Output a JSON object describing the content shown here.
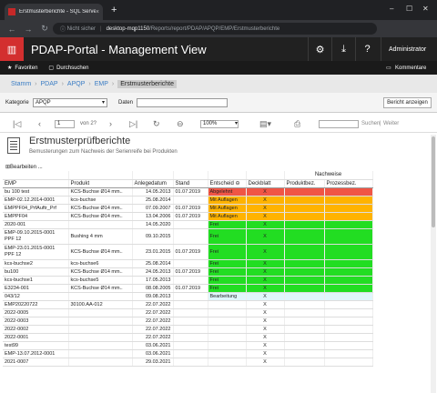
{
  "browser": {
    "tab_title": "Erstmusterberichte - SQL Server...",
    "tab_close": "×",
    "new_tab": "+",
    "win_min": "–",
    "win_max": "☐",
    "win_close": "✕",
    "security": "Nicht sicher",
    "host": "desktop-mqp1150",
    "path": "/Reports/report/PDAP/APQP/EMP/Erstmusterberichte"
  },
  "app": {
    "title": "PDAP-Portal - Management View",
    "user": "Administrator",
    "favorites": "Favoriten",
    "browse": "Durchsuchen",
    "comments": "Kommentare"
  },
  "breadcrumb": [
    "Stamm",
    "PDAP",
    "APQP",
    "EMP",
    "Erstmusterberichte"
  ],
  "params": {
    "kategorie_label": "Kategorie",
    "kategorie_value": "APQP",
    "daten_label": "Daten",
    "run": "Bericht anzeigen"
  },
  "toolbar": {
    "page": "1",
    "of": "von 2?",
    "zoom": "100%",
    "find": "Suchen",
    "next": "Weiter"
  },
  "report": {
    "title": "Erstmusterprüfberichte",
    "subtitle": "Bemusterungen zum Nachweis der Serienreife bei Produkten",
    "edit": "Bearbeiten ..."
  },
  "table": {
    "group_header": "Nachweise",
    "headers": [
      "EMP",
      "Produkt",
      "Anlegedatum",
      "Stand",
      "Entscheid",
      "Deckblatt",
      "Produktbez.",
      "Prozessbez."
    ],
    "rows": [
      [
        "bu 100 test",
        "KCS-Buchse Ø14 mm..",
        "14.05.2013",
        "01.07.2019",
        "Abgelehnt",
        "X",
        "",
        ""
      ],
      [
        "EMP-02.12.2014-0001",
        "kcs-buchse",
        "25.08.2014",
        "",
        "Mit Auflagen",
        "X",
        "",
        ""
      ],
      [
        "EMPPF04_PrfAuftr_Prf",
        "KCS-Buchse Ø14 mm..",
        "07.09.2007",
        "01.07.2019",
        "Mit Auflagen",
        "X",
        "",
        ""
      ],
      [
        "EMPPF04",
        "KCS-Buchse Ø14 mm..",
        "13.04.2006",
        "01.07.2019",
        "Mit Auflagen",
        "X",
        "",
        ""
      ],
      [
        "2020-001",
        "",
        "14.05.2020",
        "",
        "Frei",
        "X",
        "",
        ""
      ],
      [
        "EMP-09.10.2015-0001 PPF 12",
        "Bushing 4 mm",
        "09.10.2015",
        "",
        "Frei",
        "X",
        "",
        ""
      ],
      [
        "EMP-23.01.2015-0001 PPF 12",
        "KCS-Buchse Ø14 mm..",
        "23.01.2015",
        "01.07.2019",
        "Frei",
        "X",
        "",
        ""
      ],
      [
        "kcs-buchse2",
        "kcs-buchse6",
        "25.08.2014",
        "",
        "Frei",
        "X",
        "",
        ""
      ],
      [
        "bu100",
        "KCS-Buchse Ø14 mm..",
        "24.05.2013",
        "01.07.2019",
        "Frei",
        "X",
        "",
        ""
      ],
      [
        "kcs-buchse1",
        "kcs-buchse5",
        "17.05.2013",
        "",
        "Frei",
        "X",
        "",
        ""
      ],
      [
        "E3234-001",
        "KCS-Buchse Ø14 mm..",
        "08.08.2005",
        "01.07.2019",
        "Frei",
        "X",
        "",
        ""
      ],
      [
        "043/12",
        "",
        "09.08.2013",
        "",
        "Bearbeitung",
        "X",
        "",
        ""
      ],
      [
        "EMP20220722",
        "30100.AA-012",
        "22.07.2022",
        "",
        "",
        "X",
        "",
        ""
      ],
      [
        "2022-0005",
        "",
        "22.07.2022",
        "",
        "",
        "X",
        "",
        ""
      ],
      [
        "2022-0003",
        "",
        "22.07.2022",
        "",
        "",
        "X",
        "",
        ""
      ],
      [
        "2022-0002",
        "",
        "22.07.2022",
        "",
        "",
        "X",
        "",
        ""
      ],
      [
        "2022-0001",
        "",
        "22.07.2022",
        "",
        "",
        "X",
        "",
        ""
      ],
      [
        "test99",
        "",
        "03.06.2021",
        "",
        "",
        "X",
        "",
        ""
      ],
      [
        "EMP-13.07.2012-0001",
        "",
        "03.06.2021",
        "",
        "",
        "X",
        "",
        ""
      ],
      [
        "2021-0007",
        "",
        "29.03.2021",
        "",
        "",
        "X",
        "",
        ""
      ]
    ]
  },
  "colors": {
    "header_bg": "#212121",
    "accent": "#d32f2f",
    "rejected": "#f05545",
    "conditional": "#ffb300",
    "released": "#22dd22",
    "in_progress": "#e0f6fb"
  }
}
